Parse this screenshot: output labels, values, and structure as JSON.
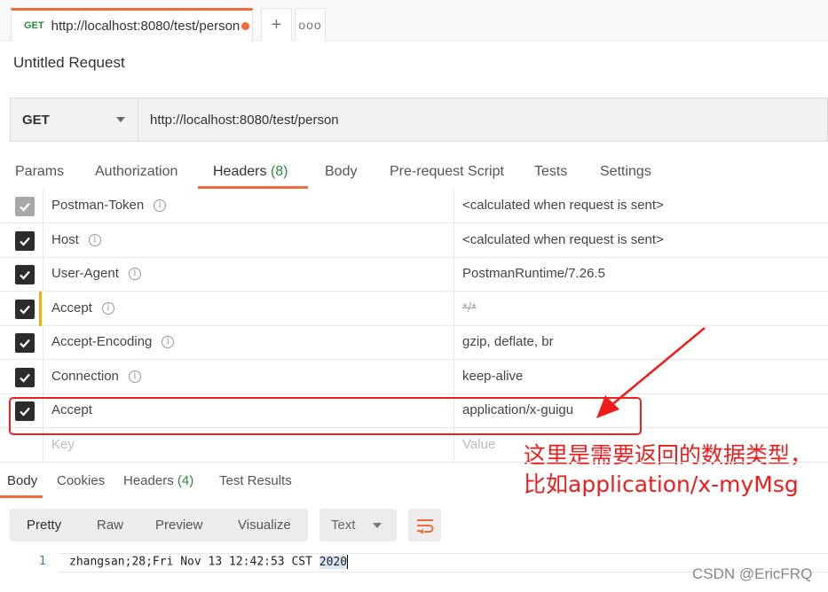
{
  "tab": {
    "method": "GET",
    "url": "http://localhost:8080/test/person",
    "new_tab_glyph": "+",
    "more_glyph": "ooo"
  },
  "request_title": "Untitled Request",
  "url_bar": {
    "method": "GET",
    "url": "http://localhost:8080/test/person"
  },
  "request_tabs": [
    {
      "label": "Params"
    },
    {
      "label": "Authorization"
    },
    {
      "label": "Headers",
      "count": "(8)"
    },
    {
      "label": "Body"
    },
    {
      "label": "Pre-request Script"
    },
    {
      "label": "Tests"
    },
    {
      "label": "Settings"
    }
  ],
  "headers": [
    {
      "key": "Postman-Token",
      "value": "<calculated when request is sent>",
      "checked": true,
      "disabled": true,
      "info": true
    },
    {
      "key": "Host",
      "value": "<calculated when request is sent>",
      "checked": true,
      "info": true
    },
    {
      "key": "User-Agent",
      "value": "PostmanRuntime/7.26.5",
      "checked": true,
      "info": true
    },
    {
      "key": "Accept",
      "value": "*/*",
      "checked": true,
      "info": true,
      "struck": true
    },
    {
      "key": "Accept-Encoding",
      "value": "gzip, deflate, br",
      "checked": true,
      "info": true
    },
    {
      "key": "Connection",
      "value": "keep-alive",
      "checked": true,
      "info": true
    },
    {
      "key": "Accept",
      "value": "application/x-guigu",
      "checked": true,
      "info": false
    }
  ],
  "new_header": {
    "key_placeholder": "Key",
    "value_placeholder": "Value"
  },
  "annotation": {
    "line1": "这里是需要返回的数据类型，",
    "line2": "比如application/x-myMsg"
  },
  "response_tabs": [
    {
      "label": "Body"
    },
    {
      "label": "Cookies"
    },
    {
      "label": "Headers",
      "count": "(4)"
    },
    {
      "label": "Test Results"
    }
  ],
  "view_modes": [
    "Pretty",
    "Raw",
    "Preview",
    "Visualize"
  ],
  "format": "Text",
  "response_body": {
    "line_number": "1",
    "text_before": "zhangsan;28;Fri Nov 13 12:42:53 CST ",
    "text_highlight": "2020"
  },
  "watermark": "CSDN @EricFRQ",
  "colors": {
    "accent": "#f26b3a",
    "green": "#2b8a3e",
    "annotation_red": "#ee1c1c"
  }
}
